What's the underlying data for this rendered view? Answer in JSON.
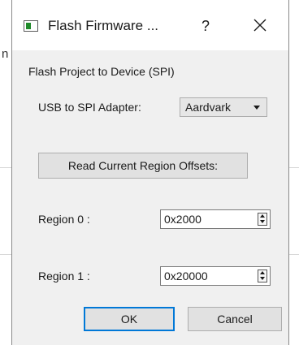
{
  "background": {
    "stray_char": "n"
  },
  "dialog": {
    "title": "Flash Firmware ...",
    "help_label": "?",
    "section_label": "Flash Project to Device (SPI)",
    "adapter": {
      "label": "USB to SPI Adapter:",
      "selected": "Aardvark"
    },
    "read_button": "Read Current Region Offsets:",
    "region0": {
      "label": "Region 0 :",
      "value": "0x2000"
    },
    "region1": {
      "label": "Region 1 :",
      "value": "0x20000"
    },
    "ok_label": "OK",
    "cancel_label": "Cancel"
  },
  "colors": {
    "accent": "#0078d7",
    "dialog_bg": "#f0f0f0",
    "icon_green": "#1f8a2a"
  }
}
